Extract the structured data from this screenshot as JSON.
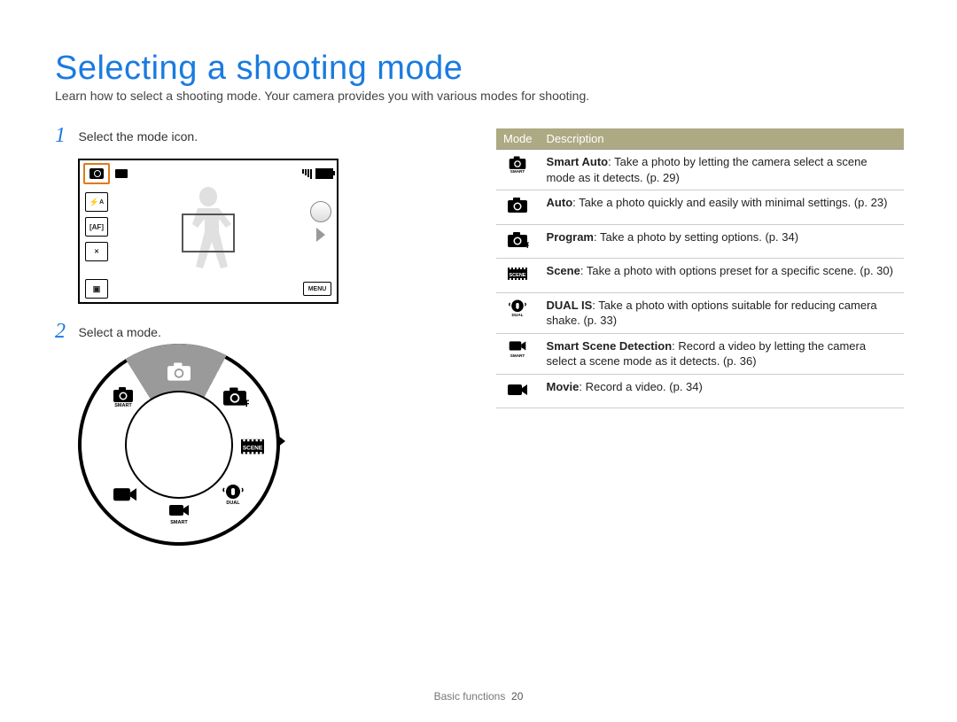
{
  "title": "Selecting a shooting mode",
  "intro": "Learn how to select a shooting mode. Your camera provides you with various modes for shooting.",
  "steps": {
    "one_num": "1",
    "one_text": "Select the mode icon.",
    "two_num": "2",
    "two_text": "Select a mode."
  },
  "screen": {
    "flash_label": "A",
    "af_label": "AF",
    "off_label": "OFF",
    "menu_label": "MENU"
  },
  "dial": {
    "modes": [
      "auto",
      "program",
      "scene",
      "dual-is",
      "smart-scene",
      "movie",
      "smart-auto"
    ]
  },
  "table": {
    "head_mode": "Mode",
    "head_desc": "Description",
    "rows": [
      {
        "icon": "smart-auto",
        "name": "Smart Auto",
        "desc": ": Take a photo by letting the camera select a scene mode as it detects. (p. 29)"
      },
      {
        "icon": "auto",
        "name": "Auto",
        "desc": ": Take a photo quickly and easily with minimal settings. (p. 23)"
      },
      {
        "icon": "program",
        "name": "Program",
        "desc": ": Take a photo by setting options. (p. 34)"
      },
      {
        "icon": "scene",
        "name": "Scene",
        "desc": ": Take a photo with options preset for a specific scene. (p. 30)"
      },
      {
        "icon": "dual-is",
        "name": "DUAL IS",
        "desc": ": Take a photo with options suitable for reducing camera shake. (p. 33)"
      },
      {
        "icon": "smart-scene",
        "name": "Smart Scene Detection",
        "desc": ": Record a video by letting the camera select a scene mode as it detects. (p. 36)"
      },
      {
        "icon": "movie",
        "name": "Movie",
        "desc": ": Record a video. (p. 34)"
      }
    ]
  },
  "footer": {
    "section": "Basic functions",
    "page": "20"
  }
}
